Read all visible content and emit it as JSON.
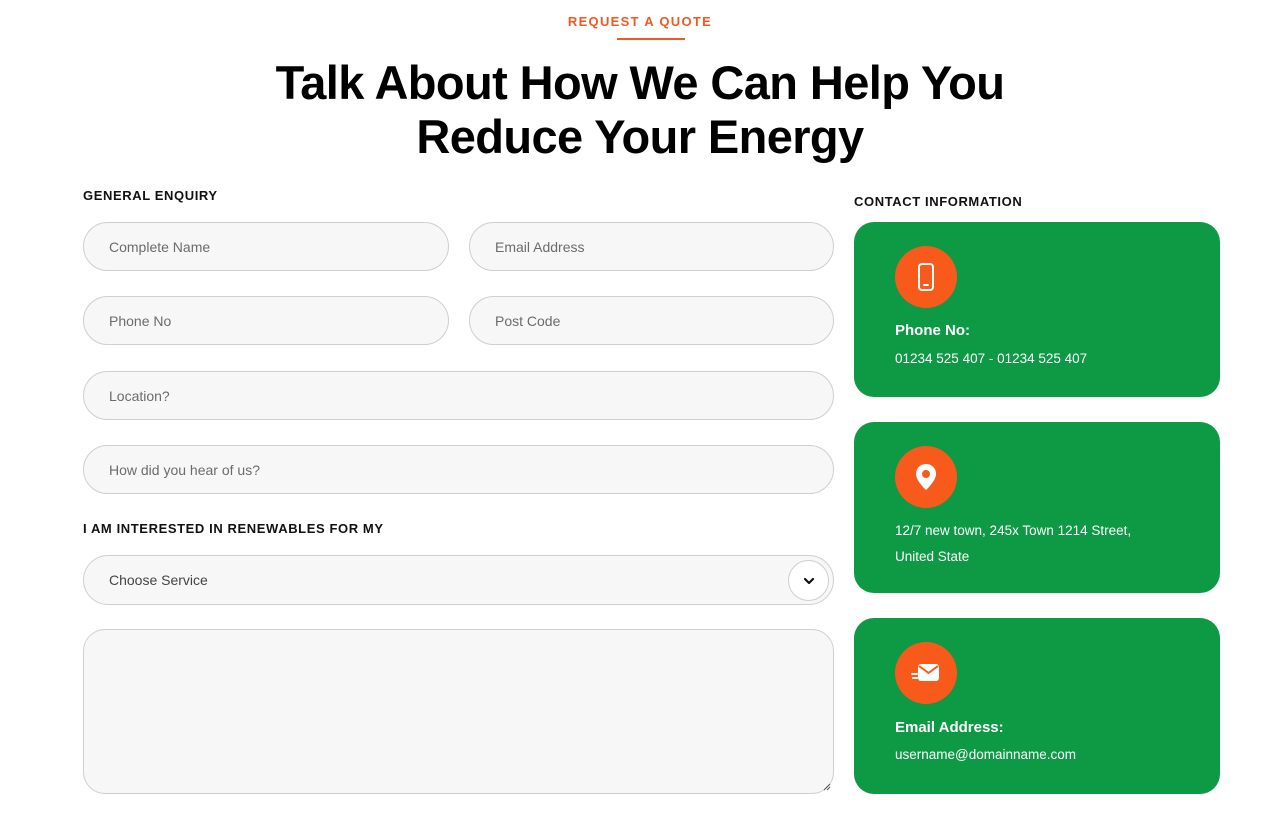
{
  "header": {
    "eyebrow": "REQUEST A QUOTE",
    "headline_line1": "Talk About How We Can Help You",
    "headline_line2": "Reduce Your Energy"
  },
  "form": {
    "section_label": "GENERAL ENQUIRY",
    "complete_name": {
      "placeholder": "Complete Name",
      "value": ""
    },
    "email_address": {
      "placeholder": "Email Address",
      "value": ""
    },
    "phone_no": {
      "placeholder": "Phone No",
      "value": ""
    },
    "post_code": {
      "placeholder": "Post Code",
      "value": ""
    },
    "location": {
      "placeholder": "Location?",
      "value": ""
    },
    "referral": {
      "placeholder": "How did you hear of us?",
      "value": ""
    },
    "interest_label": "I AM INTERESTED IN RENEWABLES FOR MY",
    "service_select": {
      "selected": "Choose Service"
    },
    "message": {
      "placeholder": "",
      "value": ""
    }
  },
  "contact": {
    "section_label": "CONTACT INFORMATION",
    "phone": {
      "icon": "mobile-phone-icon",
      "title": "Phone No:",
      "value": "01234 525 407 - 01234 525 407"
    },
    "address": {
      "icon": "location-pin-icon",
      "line1": "12/7 new town, 245x Town 1214 Street,",
      "line2": "United State"
    },
    "email": {
      "icon": "envelope-icon",
      "title": "Email Address:",
      "value": "username@domainname.com"
    }
  },
  "colors": {
    "accent": "#f05a22",
    "card_green": "#0e9944",
    "icon_circle": "#f75a1b"
  }
}
